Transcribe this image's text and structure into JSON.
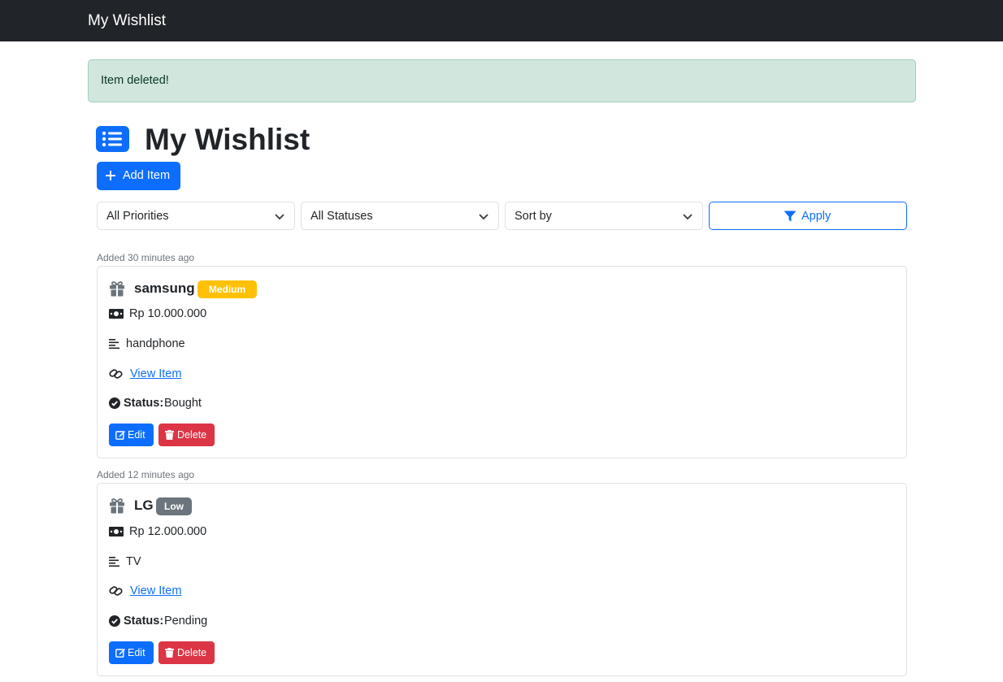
{
  "navbar": {
    "brand": "My Wishlist"
  },
  "alert": {
    "message": "Item deleted!"
  },
  "page": {
    "title": "My Wishlist",
    "title_icon": "list-icon"
  },
  "toolbar": {
    "add_label": "Add Item"
  },
  "filters": {
    "priority": "All Priorities",
    "status": "All Statuses",
    "sort": "Sort by",
    "apply_label": "Apply"
  },
  "colors": {
    "primary": "#0d6efd",
    "danger": "#dc3545",
    "warning": "#ffc107",
    "secondary": "#6c757d",
    "success_bg": "#d1e7dd",
    "navbar": "#212529"
  },
  "items": [
    {
      "added": "Added 30 minutes ago",
      "name": "samsung",
      "priority": "Medium",
      "price": "Rp 10.000.000",
      "description": "handphone",
      "link_label": "View Item",
      "status_label": "Status:",
      "status": "Bought",
      "edit_label": "Edit",
      "delete_label": "Delete"
    },
    {
      "added": "Added 12 minutes ago",
      "name": "LG",
      "priority": "Low",
      "price": "Rp 12.000.000",
      "description": "TV",
      "link_label": "View Item",
      "status_label": "Status:",
      "status": "Pending",
      "edit_label": "Edit",
      "delete_label": "Delete"
    }
  ]
}
